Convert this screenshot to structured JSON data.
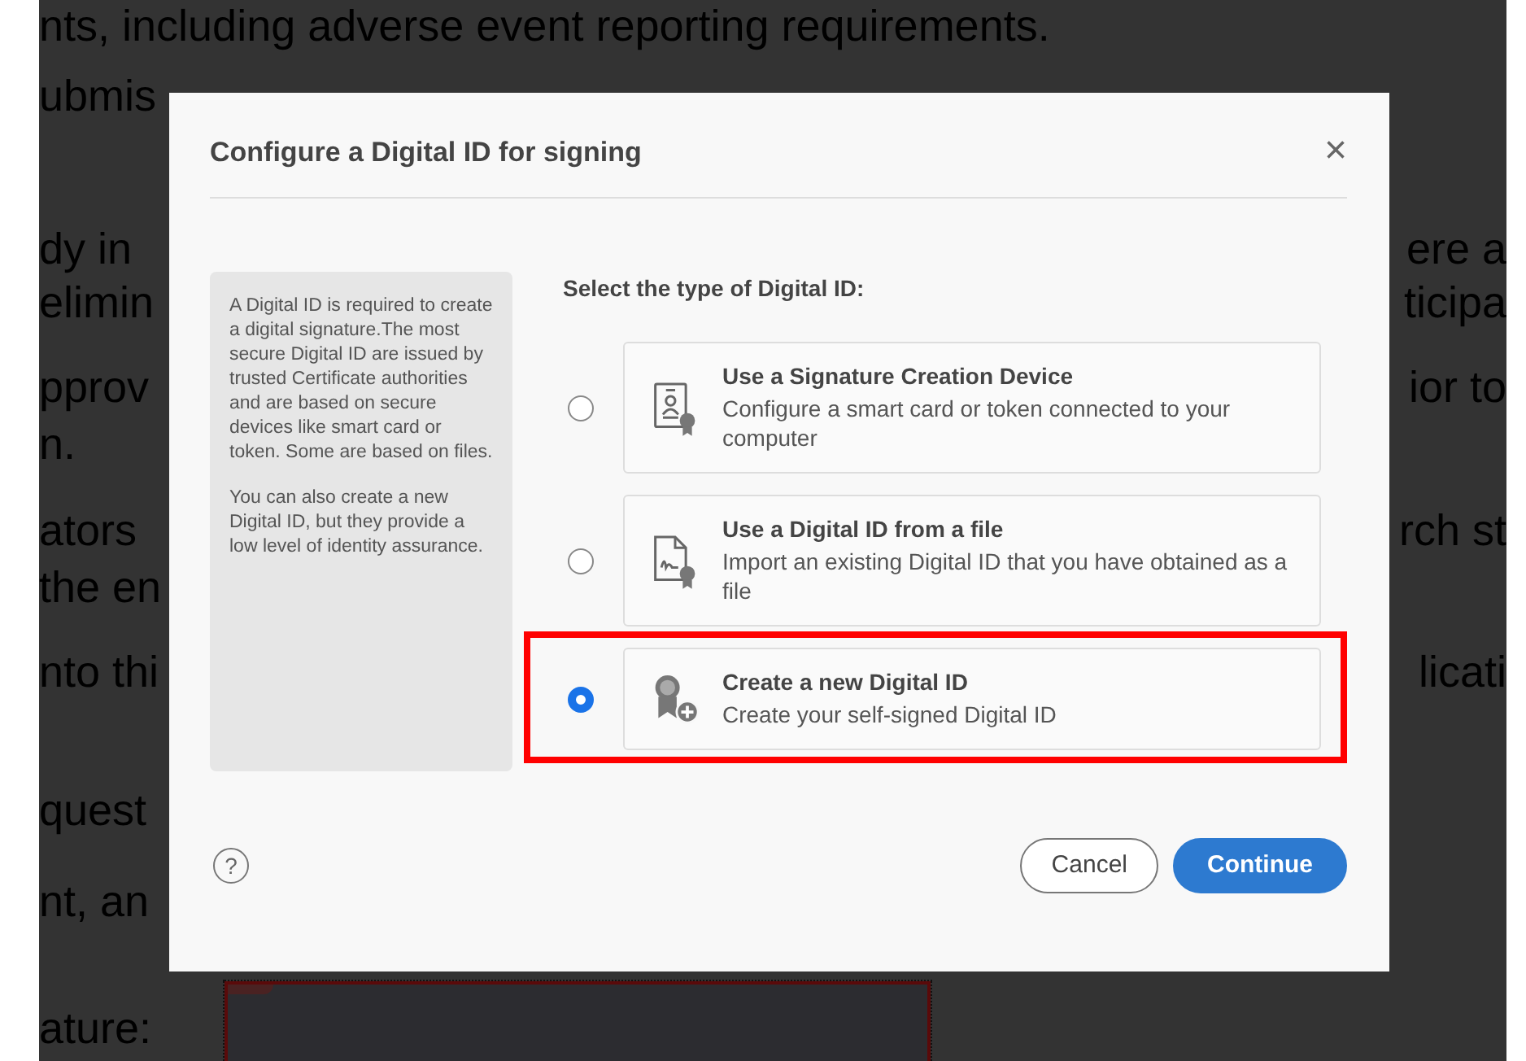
{
  "document": {
    "lines": [
      {
        "left": "nts, including adverse event reporting requirements."
      },
      {
        "left": "ubmis"
      },
      {
        "left": "dy in",
        "right": "ere a"
      },
      {
        "left": "elimin",
        "right": "ticipa"
      },
      {
        "left": "pprov",
        "right": "ior to"
      },
      {
        "left": "n."
      },
      {
        "left": "ators",
        "right": "rch st"
      },
      {
        "left": "the en"
      },
      {
        "left": "nto thi",
        "right": "licati"
      },
      {
        "left": "quest"
      },
      {
        "left": "nt, an"
      },
      {
        "left": "ature:"
      }
    ]
  },
  "dialog": {
    "title": "Configure a Digital ID for signing",
    "close": "×",
    "info": [
      "A Digital ID is required to create a digital signature.The most secure Digital ID are issued by trusted Certificate authorities and are based on secure devices like smart card or token. Some are based on files.",
      "You can also create a new Digital ID, but they provide a low level of identity assurance."
    ],
    "prompt": "Select the type of Digital ID:",
    "options": [
      {
        "kind": "device",
        "title": "Use a Signature Creation Device",
        "description": "Configure a smart card or token connected to your computer",
        "selected": false
      },
      {
        "kind": "file",
        "title": "Use a Digital ID from a file",
        "description": "Import an existing Digital ID that you have obtained as a file",
        "selected": false
      },
      {
        "kind": "new",
        "title": "Create a new Digital ID",
        "description": "Create your self-signed Digital ID",
        "selected": true
      }
    ],
    "help": "?",
    "buttons": [
      {
        "kind": "secondary",
        "label": "Cancel"
      },
      {
        "kind": "primary",
        "label": "Continue"
      }
    ]
  }
}
